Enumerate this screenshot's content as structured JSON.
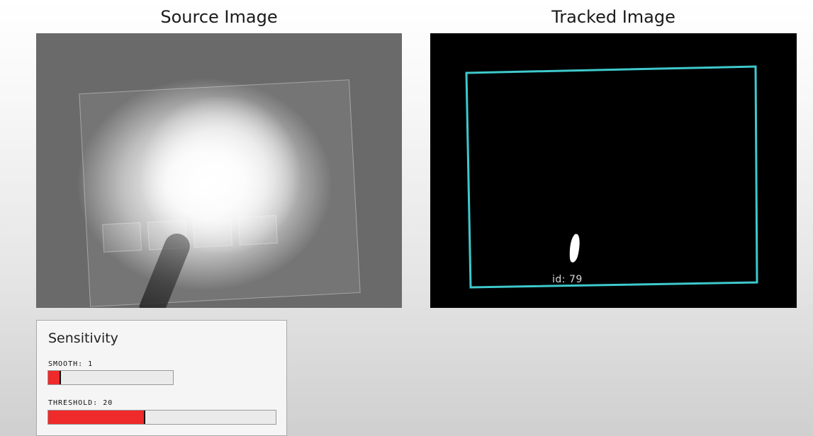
{
  "source": {
    "title": "Source Image"
  },
  "tracked": {
    "title": "Tracked Image",
    "blob": {
      "label": "id: 79"
    },
    "colors": {
      "boundary": "#3ec9cc",
      "blob": "#ffffff",
      "background": "#000000"
    }
  },
  "sensitivity": {
    "heading": "Sensitivity",
    "smooth": {
      "label": "SMOOTH: 1",
      "fill_fraction": 0.09
    },
    "threshold": {
      "label": "THRESHOLD: 20",
      "fill_fraction": 0.42
    },
    "colors": {
      "fill": "#ee2a2a"
    }
  }
}
